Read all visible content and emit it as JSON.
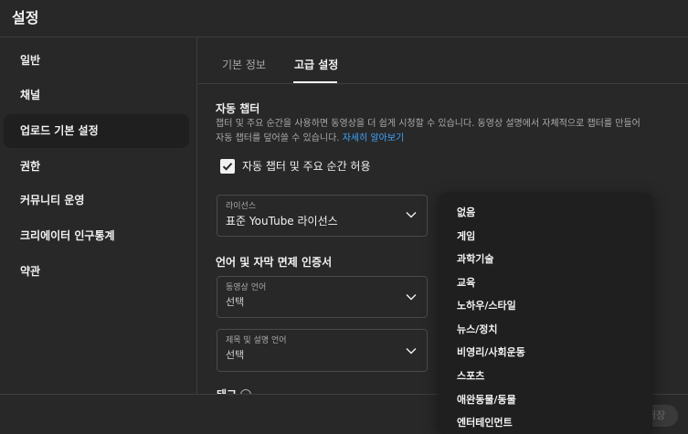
{
  "window": {
    "title": "설정"
  },
  "sidebar": {
    "items": [
      {
        "label": "일반",
        "active": false
      },
      {
        "label": "채널",
        "active": false
      },
      {
        "label": "업로드 기본 설정",
        "active": true
      },
      {
        "label": "권한",
        "active": false
      },
      {
        "label": "커뮤니티 운영",
        "active": false
      },
      {
        "label": "크리에이터 인구통계",
        "active": false
      },
      {
        "label": "약관",
        "active": false
      }
    ]
  },
  "tabs": [
    {
      "label": "기본 정보",
      "active": false
    },
    {
      "label": "고급 설정",
      "active": true
    }
  ],
  "auto_chapters": {
    "title": "자동 챕터",
    "description_line1": "챕터 및 주요 순간을 사용하면 동영상을 더 쉽게 시청할 수 있습니다. 동영상 설명에서 자체적으로 챕터를 만들어",
    "description_line2": "자동 챕터를 덮어쓸 수 있습니다.",
    "learn_more": "자세히 알아보기",
    "checkbox_label": "자동 챕터 및 주요 순간 허용",
    "checked": true
  },
  "license": {
    "label": "라이선스",
    "value": "표준 YouTube 라이선스"
  },
  "language_section": {
    "title": "언어 및 자막 면제 인증서",
    "video_language": {
      "label": "동영상 언어",
      "value": "선택"
    },
    "title_language": {
      "label": "제목 및 설명 언어",
      "value": "선택"
    }
  },
  "partial_section_title": "태그",
  "category_dropdown": {
    "options": [
      "없음",
      "게임",
      "과학기술",
      "교육",
      "노하우/스타일",
      "뉴스/정치",
      "비영리/사회운동",
      "스포츠",
      "애완동물/동물",
      "엔터테인먼트"
    ]
  },
  "footer": {
    "save_label": "저장"
  },
  "colors": {
    "background": "#282828",
    "panel": "#1f1f1f",
    "link": "#3ea6ff",
    "text": "#f1f1f1",
    "muted": "#aaaaaa"
  }
}
